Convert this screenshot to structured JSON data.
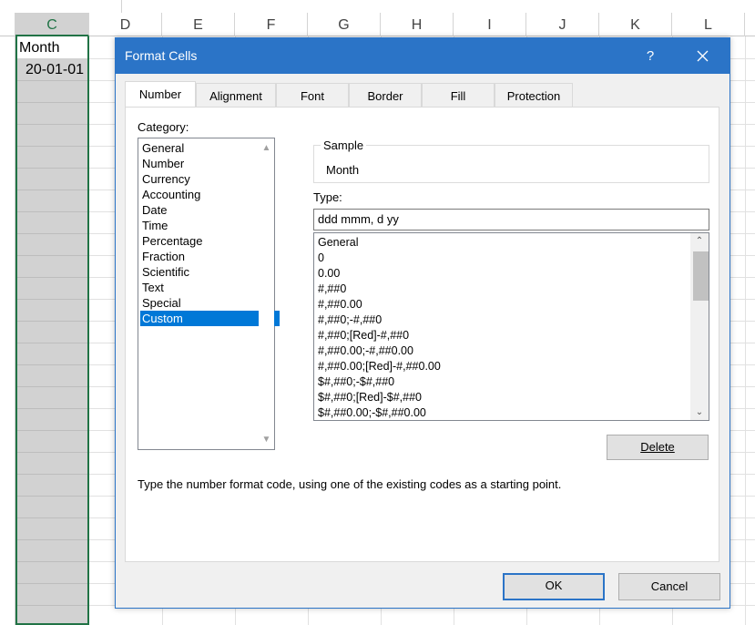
{
  "sheet": {
    "columns": [
      "C",
      "D",
      "E",
      "F",
      "G",
      "H",
      "I",
      "J",
      "K",
      "L"
    ],
    "selected_column": "C",
    "cells": {
      "c1": "Month",
      "c2": "20-01-01"
    }
  },
  "dialog": {
    "title": "Format Cells",
    "help_label": "?",
    "tabs": [
      "Number",
      "Alignment",
      "Font",
      "Border",
      "Fill",
      "Protection"
    ],
    "active_tab": "Number",
    "category_label": "Category:",
    "categories": [
      "General",
      "Number",
      "Currency",
      "Accounting",
      "Date",
      "Time",
      "Percentage",
      "Fraction",
      "Scientific",
      "Text",
      "Special",
      "Custom"
    ],
    "selected_category": "Custom",
    "sample_label": "Sample",
    "sample_value": "Month",
    "type_label": "Type:",
    "type_value": "ddd mmm, d yy",
    "type_list": [
      "General",
      "0",
      "0.00",
      "#,##0",
      "#,##0.00",
      "#,##0;-#,##0",
      "#,##0;[Red]-#,##0",
      "#,##0.00;-#,##0.00",
      "#,##0.00;[Red]-#,##0.00",
      "$#,##0;-$#,##0",
      "$#,##0;[Red]-$#,##0",
      "$#,##0.00;-$#,##0.00"
    ],
    "delete_label": "Delete",
    "description": "Type the number format code, using one of the existing codes as a starting point.",
    "ok_label": "OK",
    "cancel_label": "Cancel"
  },
  "colors": {
    "title_bar": "#2b74c7",
    "selection": "#0078d7",
    "excel_green": "#217346"
  }
}
